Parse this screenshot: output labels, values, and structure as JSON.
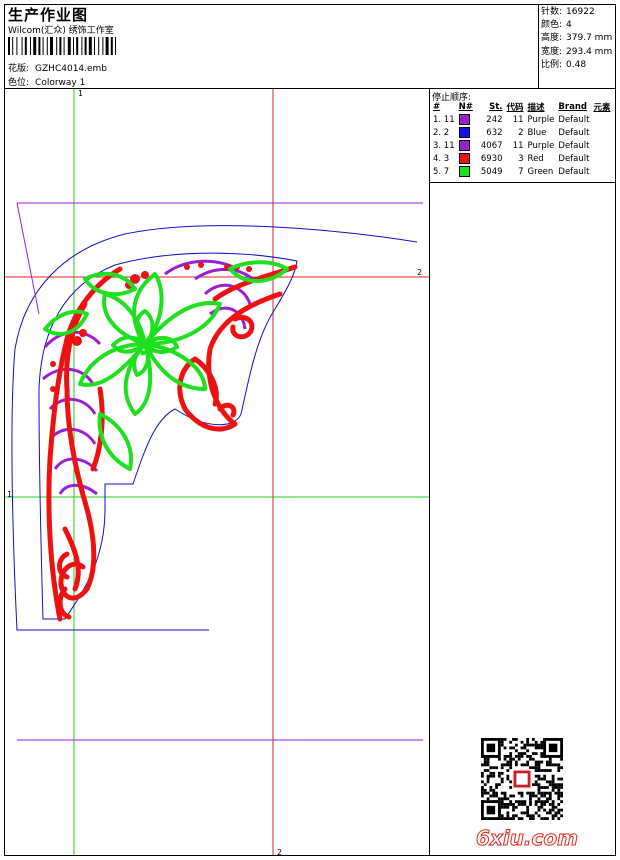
{
  "header": {
    "title": "生产作业图",
    "subtitle": "Wilcom(汇众) 绣饰工作室",
    "design_label": "花版:",
    "design_value": "GZHC4014.emb",
    "colorway_label": "色位:",
    "colorway_value": "Colorway 1"
  },
  "stats": {
    "stitches_label": "针数:",
    "stitches_value": "16922",
    "colors_label": "颜色:",
    "colors_value": "4",
    "height_label": "高度:",
    "height_value": "379.7 mm",
    "width_label": "宽度:",
    "width_value": "293.4 mm",
    "scale_label": "比例:",
    "scale_value": "0.48"
  },
  "sequence": {
    "title": "停止顺序:",
    "headers": [
      "#",
      "N#",
      "St.",
      "代码",
      "描述",
      "Brand",
      "元素"
    ],
    "rows": [
      {
        "idx": "1. 11",
        "color": "#9a1fd0",
        "st": "242",
        "code": "11",
        "desc": "Purple",
        "brand": "Default"
      },
      {
        "idx": "2. 2",
        "color": "#1010e8",
        "st": "632",
        "code": "2",
        "desc": "Blue",
        "brand": "Default"
      },
      {
        "idx": "3. 11",
        "color": "#9a1fd0",
        "st": "4067",
        "code": "11",
        "desc": "Purple",
        "brand": "Default"
      },
      {
        "idx": "4. 3",
        "color": "#ee1111",
        "st": "6930",
        "code": "3",
        "desc": "Red",
        "brand": "Default"
      },
      {
        "idx": "5. 7",
        "color": "#1ee01e",
        "st": "5049",
        "code": "7",
        "desc": "Green",
        "brand": "Default"
      }
    ]
  },
  "axis": {
    "v1_top": "1",
    "h2_right": "2",
    "v2_bottom": "2",
    "h1_left": "1"
  },
  "brand_logo": "6xiu.com",
  "colors": {
    "red": "#ee1111",
    "green": "#1ee01e",
    "purple": "#9a1fd0",
    "blue": "#1010c8",
    "guide_green": "#22cc22",
    "guide_red": "#dd2222",
    "guide_purple": "#9a1fd0"
  }
}
